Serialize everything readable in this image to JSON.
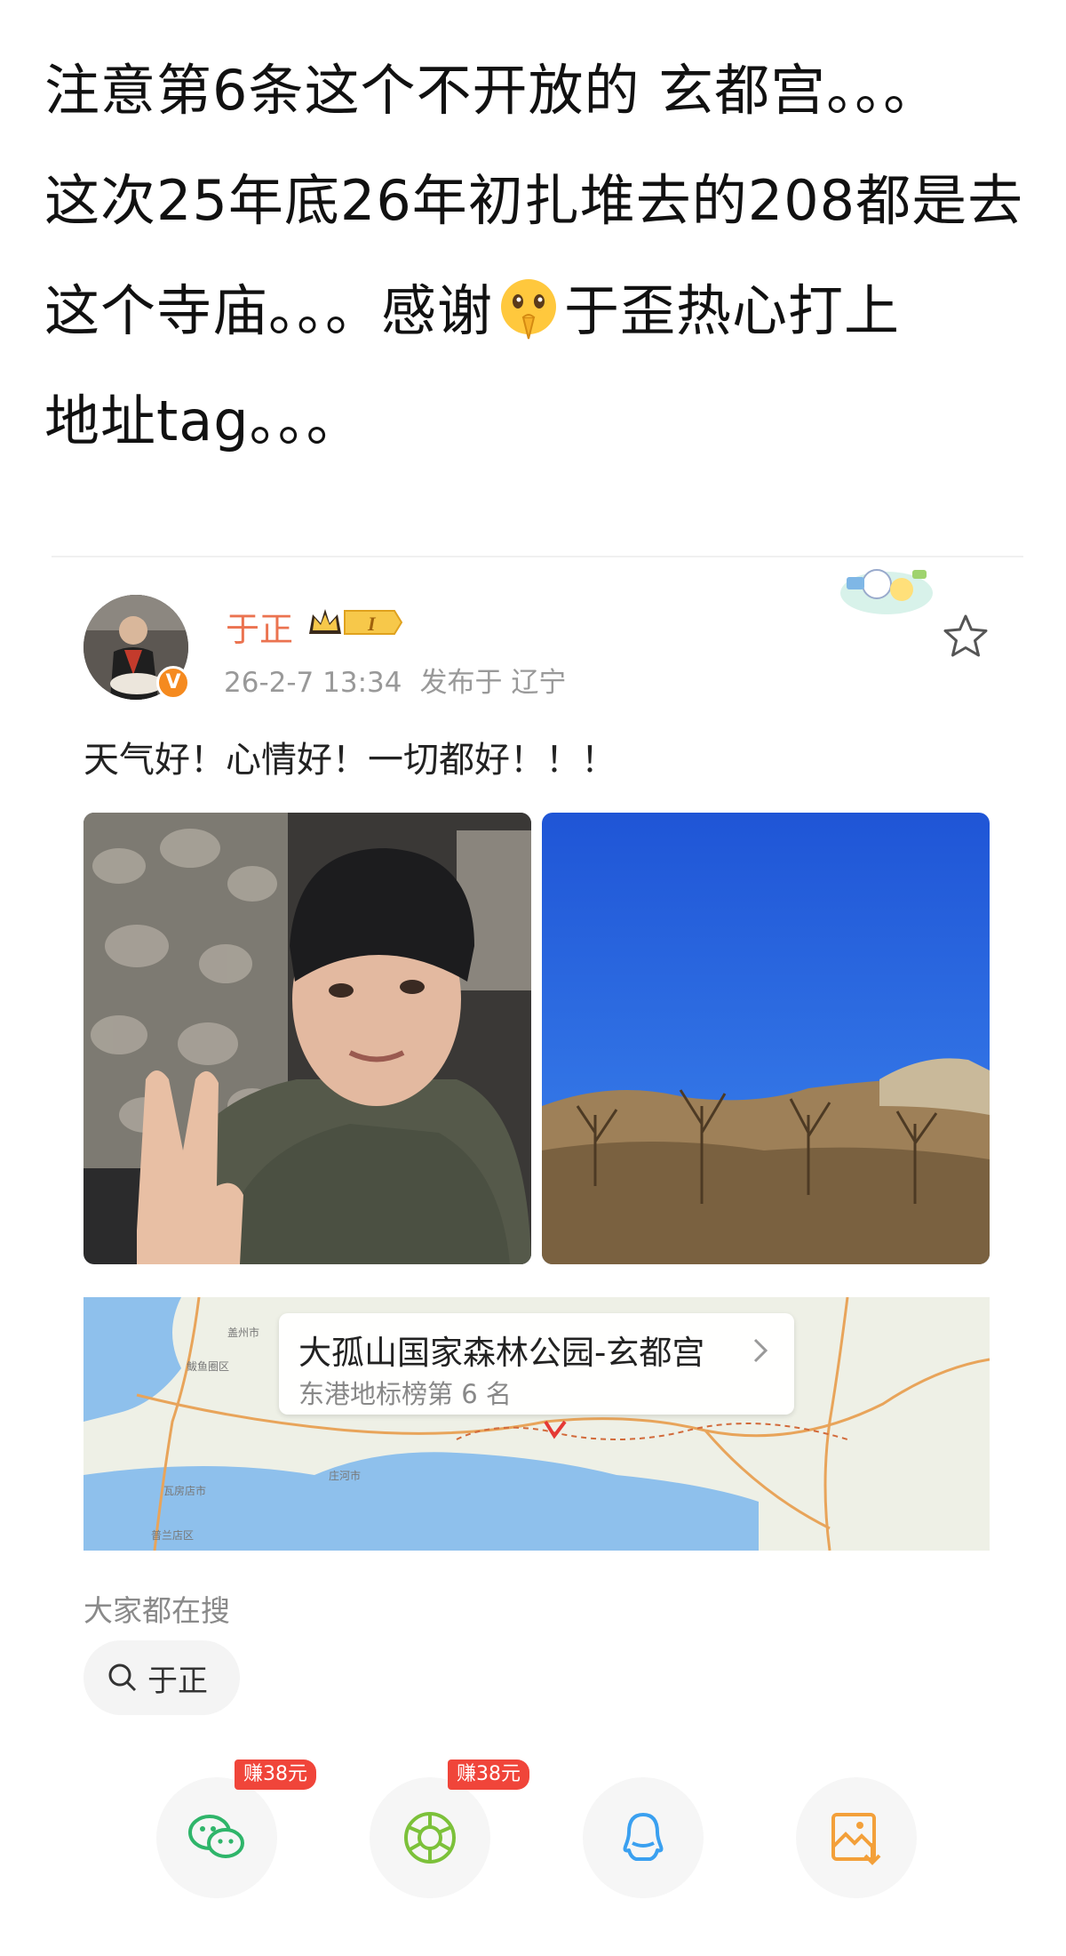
{
  "caption": {
    "line1": "注意第6条这个不开放的 玄都宫。。。",
    "line2": "这次25年底26年初扎堆去的208都是去",
    "line3_pre": "这个寺庙。。。感谢",
    "line3_post": "于歪热心打上",
    "line4": "地址tag。。。"
  },
  "post": {
    "username": "于正",
    "level": "I",
    "timestamp": "26-2-7 13:34",
    "location": "发布于 辽宁",
    "text": "天气好！心情好！一切都好！！！",
    "verified_badge": "V"
  },
  "map": {
    "place_title": "大孤山国家森林公园-玄都宫",
    "place_subtitle": "东港地标榜第 6 名",
    "city_labels": [
      "盖州市",
      "鲅鱼圈区",
      "庄河市",
      "瓦房店市",
      "普兰店区"
    ]
  },
  "search": {
    "label": "大家都在搜",
    "chip": "于正"
  },
  "share": {
    "buttons": [
      {
        "name": "wechat",
        "icon": "wechat-icon",
        "reward": "赚38元"
      },
      {
        "name": "moments",
        "icon": "moments-icon",
        "reward": "赚38元"
      },
      {
        "name": "qq",
        "icon": "qq-icon",
        "reward": ""
      },
      {
        "name": "save-image",
        "icon": "save-image-icon",
        "reward": ""
      }
    ]
  },
  "colors": {
    "username": "#eb7350",
    "reward_badge": "#f0453a",
    "wechat": "#2fb56a",
    "qq": "#3aa0f0",
    "save": "#f3a03a"
  }
}
